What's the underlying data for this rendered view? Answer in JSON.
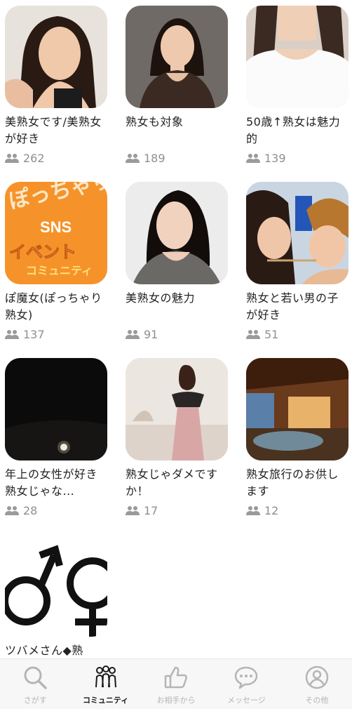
{
  "communities": [
    {
      "title": "美熟女です/美熟女が好き",
      "count": "262"
    },
    {
      "title": "熟女も対象",
      "count": "189"
    },
    {
      "title": "50歳↑熟女は魅力的",
      "count": "139"
    },
    {
      "title": "ぽ魔女(ぽっちゃり熟女)",
      "count": "137",
      "thumb_text": {
        "line1": "ぽっちゃり",
        "line2": "SNS",
        "line3": "イベント",
        "line4": "コミュニティ"
      }
    },
    {
      "title": "美熟女の魅力",
      "count": "91"
    },
    {
      "title": "熟女と若い男の子が好き",
      "count": "51"
    },
    {
      "title": "年上の女性が好き熟女じゃな...",
      "count": "28"
    },
    {
      "title": "熟女じゃダメですか！",
      "count": "17"
    },
    {
      "title": "熟女旅行のお供します",
      "count": "12"
    },
    {
      "title": "ツバメさん◆熟",
      "count": ""
    }
  ],
  "tabs": [
    {
      "label": "さがす",
      "icon": "search-icon",
      "active": false
    },
    {
      "label": "コミュニティ",
      "icon": "community-icon",
      "active": true
    },
    {
      "label": "お相手から",
      "icon": "like-icon",
      "active": false
    },
    {
      "label": "メッセージ",
      "icon": "message-icon",
      "active": false
    },
    {
      "label": "その他",
      "icon": "profile-icon",
      "active": false
    }
  ],
  "colors": {
    "inactive_tab": "#b5b5b5",
    "active_tab": "#1a1a1a",
    "member_count": "#8f8f8f",
    "tab_background": "#f7f7f7"
  }
}
